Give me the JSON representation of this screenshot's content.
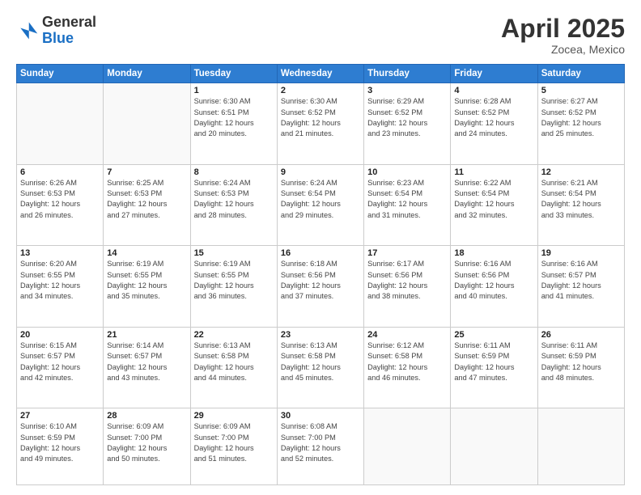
{
  "logo": {
    "general": "General",
    "blue": "Blue"
  },
  "title": {
    "month": "April 2025",
    "location": "Zocea, Mexico"
  },
  "weekdays": [
    "Sunday",
    "Monday",
    "Tuesday",
    "Wednesday",
    "Thursday",
    "Friday",
    "Saturday"
  ],
  "weeks": [
    [
      {
        "day": "",
        "info": ""
      },
      {
        "day": "",
        "info": ""
      },
      {
        "day": "1",
        "info": "Sunrise: 6:30 AM\nSunset: 6:51 PM\nDaylight: 12 hours\nand 20 minutes."
      },
      {
        "day": "2",
        "info": "Sunrise: 6:30 AM\nSunset: 6:52 PM\nDaylight: 12 hours\nand 21 minutes."
      },
      {
        "day": "3",
        "info": "Sunrise: 6:29 AM\nSunset: 6:52 PM\nDaylight: 12 hours\nand 23 minutes."
      },
      {
        "day": "4",
        "info": "Sunrise: 6:28 AM\nSunset: 6:52 PM\nDaylight: 12 hours\nand 24 minutes."
      },
      {
        "day": "5",
        "info": "Sunrise: 6:27 AM\nSunset: 6:52 PM\nDaylight: 12 hours\nand 25 minutes."
      }
    ],
    [
      {
        "day": "6",
        "info": "Sunrise: 6:26 AM\nSunset: 6:53 PM\nDaylight: 12 hours\nand 26 minutes."
      },
      {
        "day": "7",
        "info": "Sunrise: 6:25 AM\nSunset: 6:53 PM\nDaylight: 12 hours\nand 27 minutes."
      },
      {
        "day": "8",
        "info": "Sunrise: 6:24 AM\nSunset: 6:53 PM\nDaylight: 12 hours\nand 28 minutes."
      },
      {
        "day": "9",
        "info": "Sunrise: 6:24 AM\nSunset: 6:54 PM\nDaylight: 12 hours\nand 29 minutes."
      },
      {
        "day": "10",
        "info": "Sunrise: 6:23 AM\nSunset: 6:54 PM\nDaylight: 12 hours\nand 31 minutes."
      },
      {
        "day": "11",
        "info": "Sunrise: 6:22 AM\nSunset: 6:54 PM\nDaylight: 12 hours\nand 32 minutes."
      },
      {
        "day": "12",
        "info": "Sunrise: 6:21 AM\nSunset: 6:54 PM\nDaylight: 12 hours\nand 33 minutes."
      }
    ],
    [
      {
        "day": "13",
        "info": "Sunrise: 6:20 AM\nSunset: 6:55 PM\nDaylight: 12 hours\nand 34 minutes."
      },
      {
        "day": "14",
        "info": "Sunrise: 6:19 AM\nSunset: 6:55 PM\nDaylight: 12 hours\nand 35 minutes."
      },
      {
        "day": "15",
        "info": "Sunrise: 6:19 AM\nSunset: 6:55 PM\nDaylight: 12 hours\nand 36 minutes."
      },
      {
        "day": "16",
        "info": "Sunrise: 6:18 AM\nSunset: 6:56 PM\nDaylight: 12 hours\nand 37 minutes."
      },
      {
        "day": "17",
        "info": "Sunrise: 6:17 AM\nSunset: 6:56 PM\nDaylight: 12 hours\nand 38 minutes."
      },
      {
        "day": "18",
        "info": "Sunrise: 6:16 AM\nSunset: 6:56 PM\nDaylight: 12 hours\nand 40 minutes."
      },
      {
        "day": "19",
        "info": "Sunrise: 6:16 AM\nSunset: 6:57 PM\nDaylight: 12 hours\nand 41 minutes."
      }
    ],
    [
      {
        "day": "20",
        "info": "Sunrise: 6:15 AM\nSunset: 6:57 PM\nDaylight: 12 hours\nand 42 minutes."
      },
      {
        "day": "21",
        "info": "Sunrise: 6:14 AM\nSunset: 6:57 PM\nDaylight: 12 hours\nand 43 minutes."
      },
      {
        "day": "22",
        "info": "Sunrise: 6:13 AM\nSunset: 6:58 PM\nDaylight: 12 hours\nand 44 minutes."
      },
      {
        "day": "23",
        "info": "Sunrise: 6:13 AM\nSunset: 6:58 PM\nDaylight: 12 hours\nand 45 minutes."
      },
      {
        "day": "24",
        "info": "Sunrise: 6:12 AM\nSunset: 6:58 PM\nDaylight: 12 hours\nand 46 minutes."
      },
      {
        "day": "25",
        "info": "Sunrise: 6:11 AM\nSunset: 6:59 PM\nDaylight: 12 hours\nand 47 minutes."
      },
      {
        "day": "26",
        "info": "Sunrise: 6:11 AM\nSunset: 6:59 PM\nDaylight: 12 hours\nand 48 minutes."
      }
    ],
    [
      {
        "day": "27",
        "info": "Sunrise: 6:10 AM\nSunset: 6:59 PM\nDaylight: 12 hours\nand 49 minutes."
      },
      {
        "day": "28",
        "info": "Sunrise: 6:09 AM\nSunset: 7:00 PM\nDaylight: 12 hours\nand 50 minutes."
      },
      {
        "day": "29",
        "info": "Sunrise: 6:09 AM\nSunset: 7:00 PM\nDaylight: 12 hours\nand 51 minutes."
      },
      {
        "day": "30",
        "info": "Sunrise: 6:08 AM\nSunset: 7:00 PM\nDaylight: 12 hours\nand 52 minutes."
      },
      {
        "day": "",
        "info": ""
      },
      {
        "day": "",
        "info": ""
      },
      {
        "day": "",
        "info": ""
      }
    ]
  ]
}
